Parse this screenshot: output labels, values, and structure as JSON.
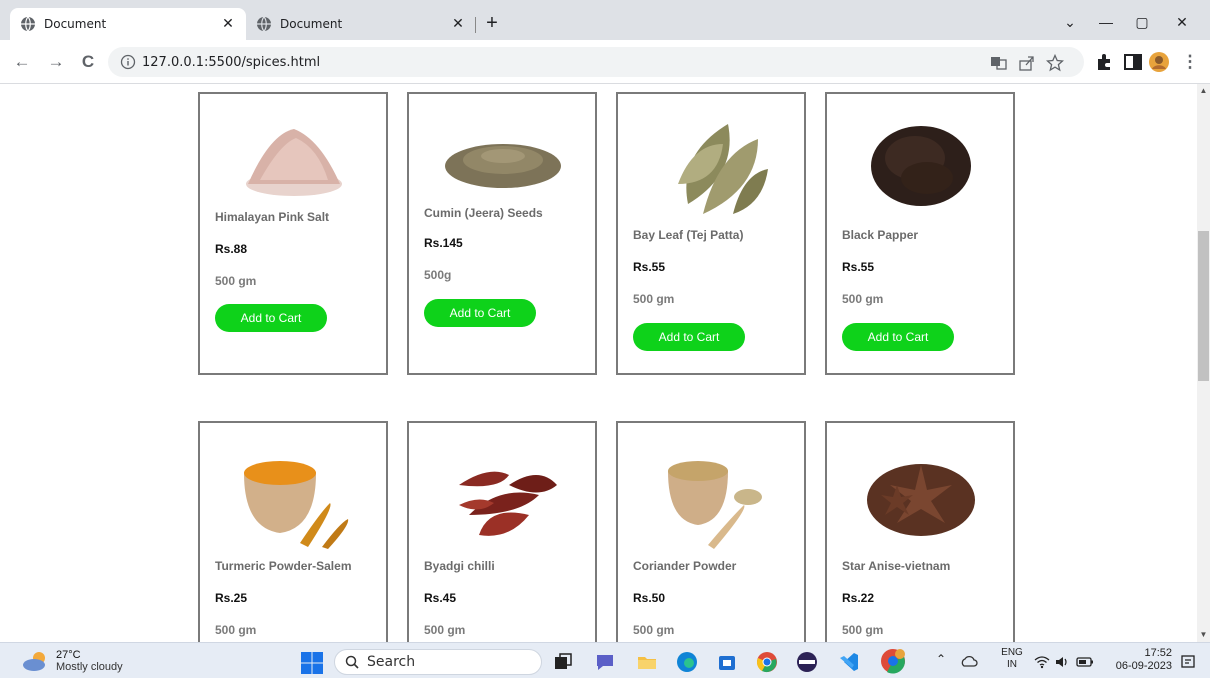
{
  "browser": {
    "tabs": [
      {
        "title": "Document",
        "active": true
      },
      {
        "title": "Document",
        "active": false
      }
    ],
    "new_tab_symbol": "+",
    "url": "127.0.0.1:5500/spices.html",
    "window_controls": {
      "chevron": "⌄",
      "minimize": "—",
      "restore": "▢",
      "close": "✕"
    },
    "nav": {
      "back": "←",
      "forward": "→",
      "reload": "C"
    },
    "overflow_symbol": "⋮"
  },
  "products": [
    {
      "name": "Himalayan Pink Salt",
      "price": "Rs.88",
      "qty": "500 gm",
      "button": "Add to Cart",
      "image": "pink-salt-image"
    },
    {
      "name": "Cumin (Jeera) Seeds",
      "price": "Rs.145",
      "qty": "500g",
      "button": "Add to Cart",
      "image": "cumin-seeds-image"
    },
    {
      "name": "Bay Leaf (Tej Patta)",
      "price": "Rs.55",
      "qty": "500 gm",
      "button": "Add to Cart",
      "image": "bay-leaf-image"
    },
    {
      "name": "Black Papper",
      "price": "Rs.55",
      "qty": "500 gm",
      "button": "Add to Cart",
      "image": "black-pepper-image"
    },
    {
      "name": "Turmeric Powder-Salem",
      "price": "Rs.25",
      "qty": "500 gm",
      "image": "turmeric-image"
    },
    {
      "name": "Byadgi chilli",
      "price": "Rs.45",
      "qty": "500 gm",
      "image": "chilli-image"
    },
    {
      "name": "Coriander Powder",
      "price": "Rs.50",
      "qty": "500 gm",
      "image": "coriander-image"
    },
    {
      "name": "Star Anise-vietnam",
      "price": "Rs.22",
      "qty": "500 gm",
      "image": "star-anise-image"
    }
  ],
  "taskbar": {
    "weather_temp": "27°C",
    "weather_condition": "Mostly cloudy",
    "search_label": "Search",
    "language_line1": "ENG",
    "language_line2": "IN",
    "time": "17:52",
    "date": "06-09-2023"
  },
  "colors": {
    "add_to_cart": "#0ed21a",
    "card_border": "#7a7a7a",
    "taskbar": "#e6ecf5"
  }
}
